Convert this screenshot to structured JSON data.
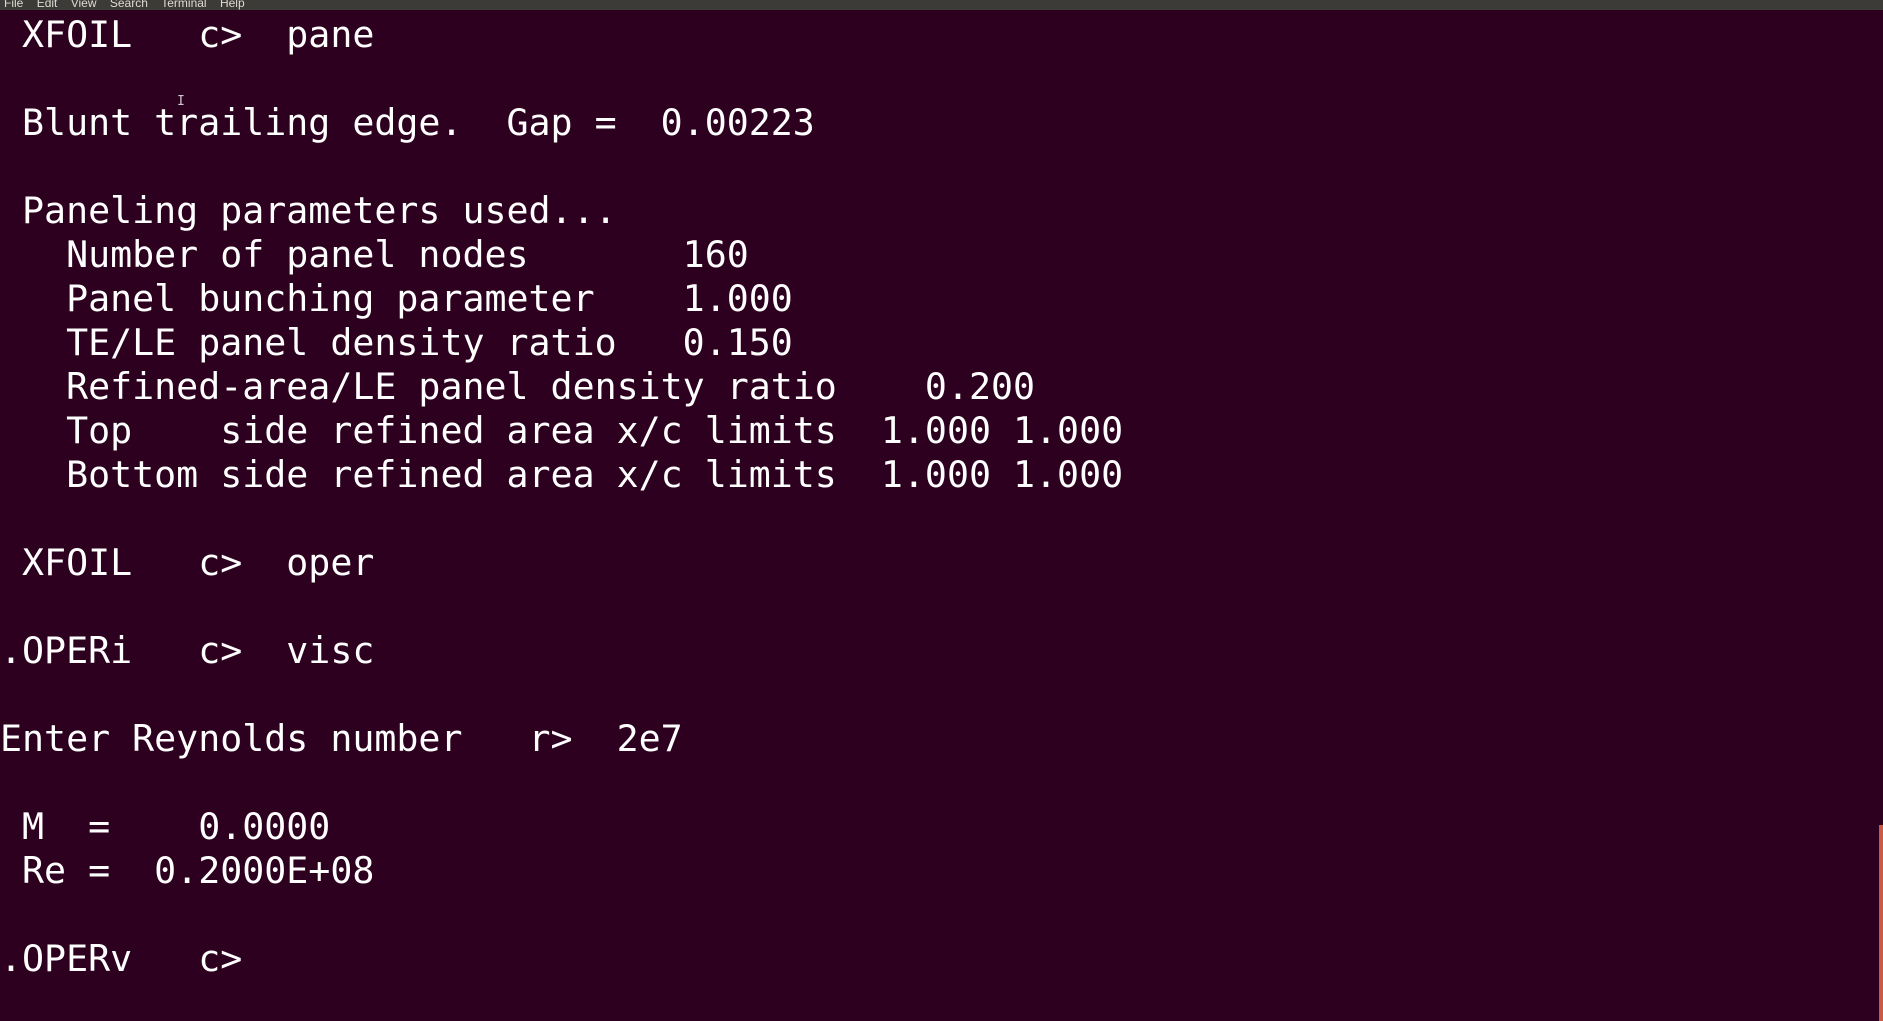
{
  "menu": {
    "items": [
      "File",
      "Edit",
      "View",
      "Search",
      "Terminal",
      "Help"
    ]
  },
  "terminal": {
    "lines": [
      " XFOIL   c>  pane",
      " Blunt trailing edge.  Gap =  0.00223",
      " Paneling parameters used...",
      "   Number of panel nodes       160",
      "   Panel bunching parameter    1.000",
      "   TE/LE panel density ratio   0.150",
      "   Refined-area/LE panel density ratio    0.200",
      "   Top    side refined area x/c limits  1.000 1.000",
      "   Bottom side refined area x/c limits  1.000 1.000",
      " XFOIL   c>  oper",
      ".OPERi   c>  visc",
      "Enter Reynolds number   r>  2e7",
      " M  =    0.0000",
      " Re =  0.2000E+08",
      ".OPERv   c> "
    ]
  },
  "colors": {
    "background": "#2c001e",
    "text": "#ffffff",
    "scrollbar_thumb": "#c85a46"
  }
}
